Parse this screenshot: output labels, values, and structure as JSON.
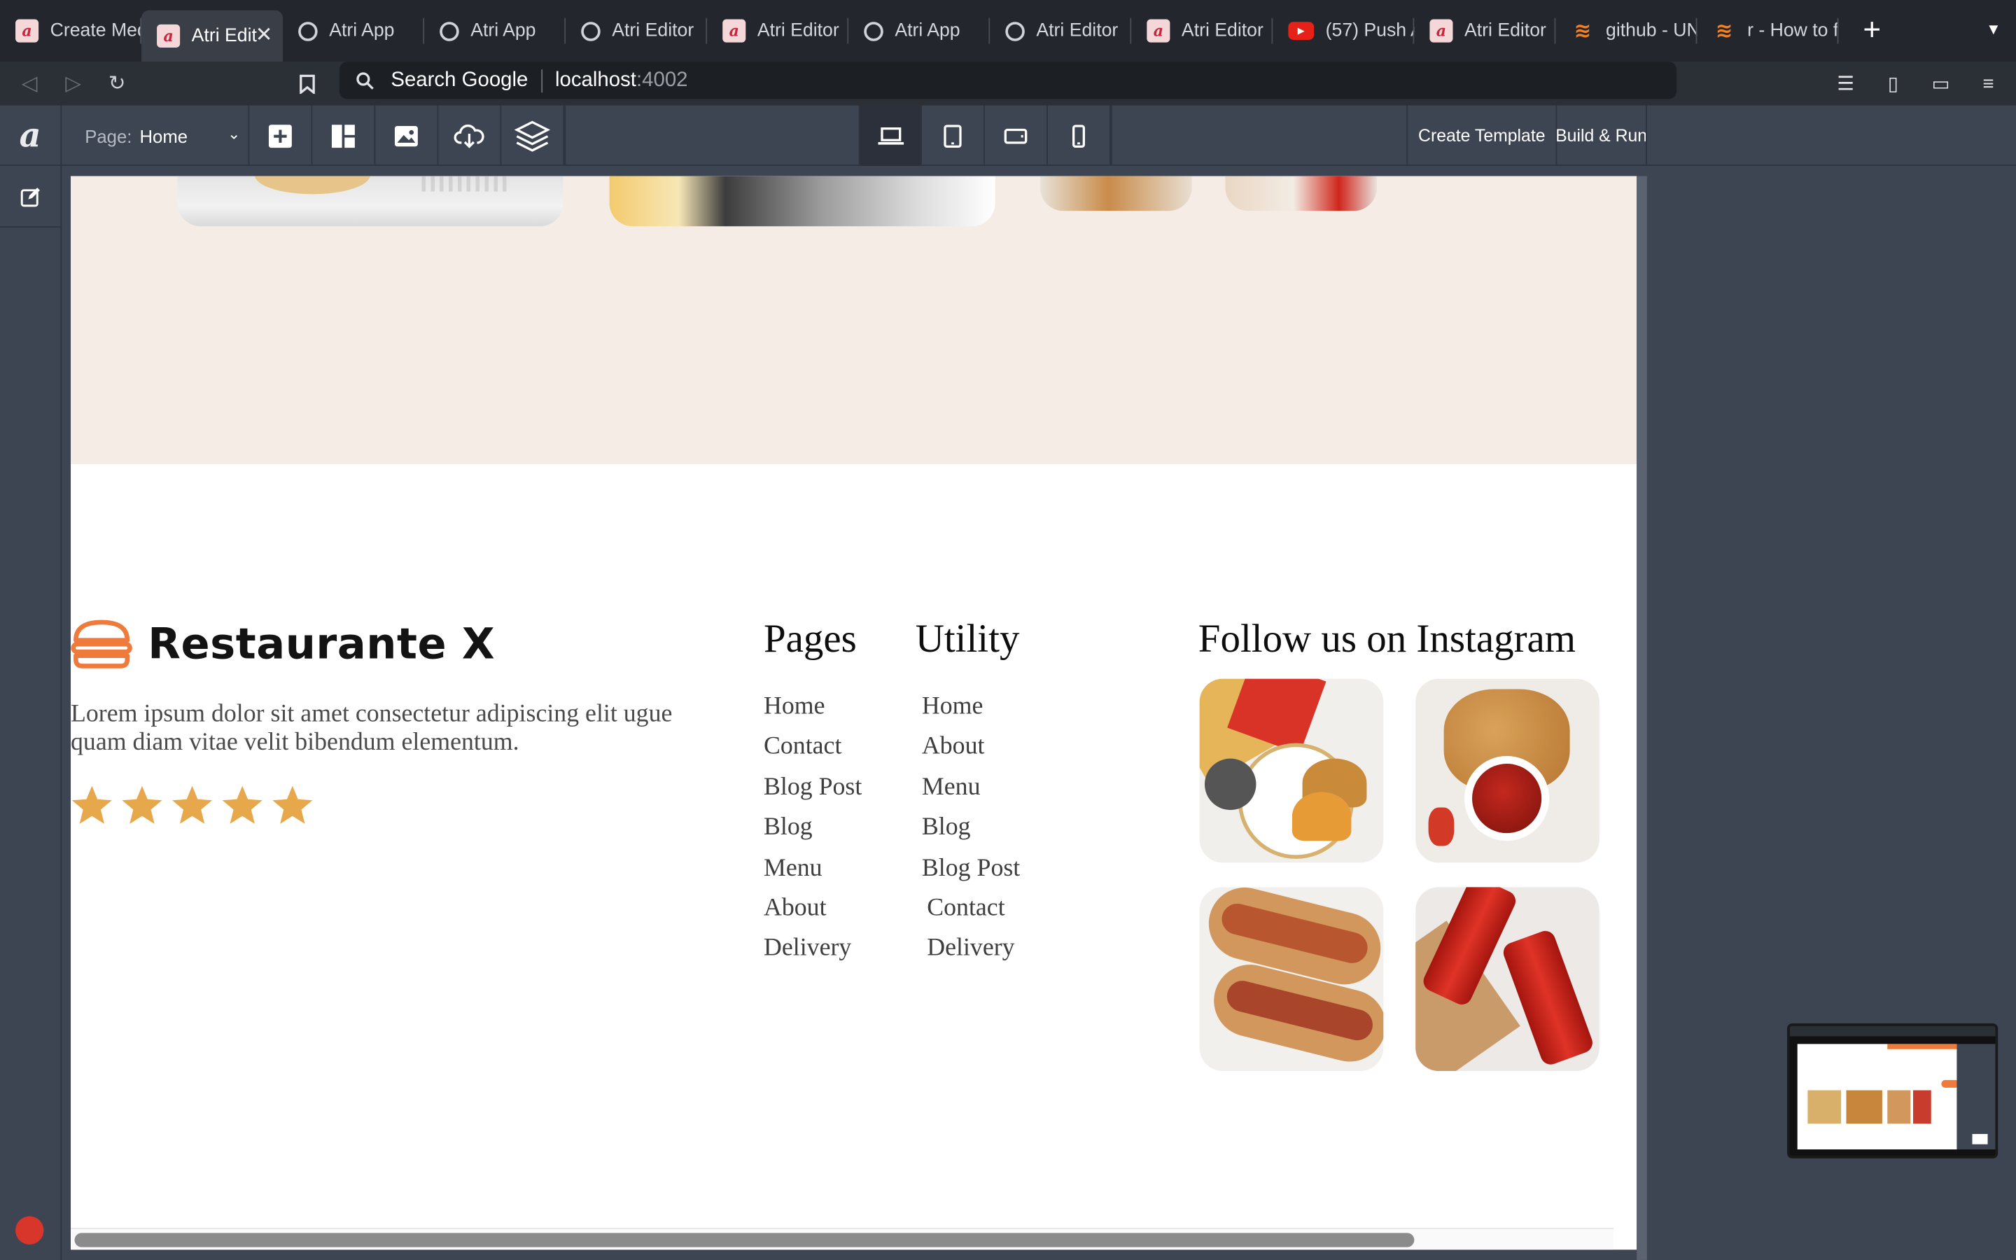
{
  "browser": {
    "tabs": [
      {
        "title": "Create Med",
        "favicon": "atri-logo-icon",
        "active": false
      },
      {
        "title": "Atri Edit",
        "favicon": "atri-logo-icon",
        "active": true
      },
      {
        "title": "Atri App",
        "favicon": "globe-icon",
        "active": false
      },
      {
        "title": "Atri App",
        "favicon": "globe-icon",
        "active": false
      },
      {
        "title": "Atri Editor",
        "favicon": "globe-icon",
        "active": false
      },
      {
        "title": "Atri Editor",
        "favicon": "atri-logo-icon",
        "active": false
      },
      {
        "title": "Atri App",
        "favicon": "globe-icon",
        "active": false
      },
      {
        "title": "Atri Editor",
        "favicon": "globe-icon",
        "active": false
      },
      {
        "title": "Atri Editor",
        "favicon": "atri-logo-icon",
        "active": false
      },
      {
        "title": "(57) Push A",
        "favicon": "youtube-icon",
        "active": false
      },
      {
        "title": "Atri Editor",
        "favicon": "atri-logo-icon",
        "active": false
      },
      {
        "title": "github - UN",
        "favicon": "stackoverflow-icon",
        "active": false
      },
      {
        "title": "r - How to f",
        "favicon": "stackoverflow-icon",
        "active": false
      }
    ],
    "new_tab": "+",
    "address": {
      "search_label": "Search Google",
      "host": "localhost",
      "port": ":4002"
    }
  },
  "editor": {
    "logo": "a",
    "page_label": "Page:",
    "page_value": "Home",
    "create_template": "Create Template",
    "build_run": "Build & Run",
    "devices": [
      "laptop-icon",
      "tablet-icon",
      "tablet-landscape-icon",
      "mobile-icon"
    ],
    "active_device": "laptop-icon"
  },
  "site": {
    "brand": "Restaurante X",
    "description": "Lorem ipsum dolor sit amet consectetur adipiscing elit ugue quam diam vitae velit bibendum elementum.",
    "rating": {
      "value": 5,
      "max": 5
    },
    "pages": {
      "title": "Pages",
      "links": [
        "Home",
        "Contact",
        "Blog Post",
        "Blog",
        "Menu",
        "About",
        "Delivery"
      ]
    },
    "utility": {
      "title": "Utility",
      "links": [
        "Home",
        "About",
        "Menu",
        "Blog",
        "Blog Post",
        "Contact",
        "Delivery"
      ]
    },
    "instagram": {
      "title": "Follow us on Instagram",
      "images": [
        "burger-and-fries-photo",
        "potato-wedges-ketchup-photo",
        "hot-dogs-photo",
        "coca-cola-cans-photo"
      ]
    }
  },
  "colors": {
    "accent": "#ee7a3c",
    "star": "#e6a84a",
    "canvas_band": "#f6ece6",
    "chrome": "#3d4452"
  }
}
